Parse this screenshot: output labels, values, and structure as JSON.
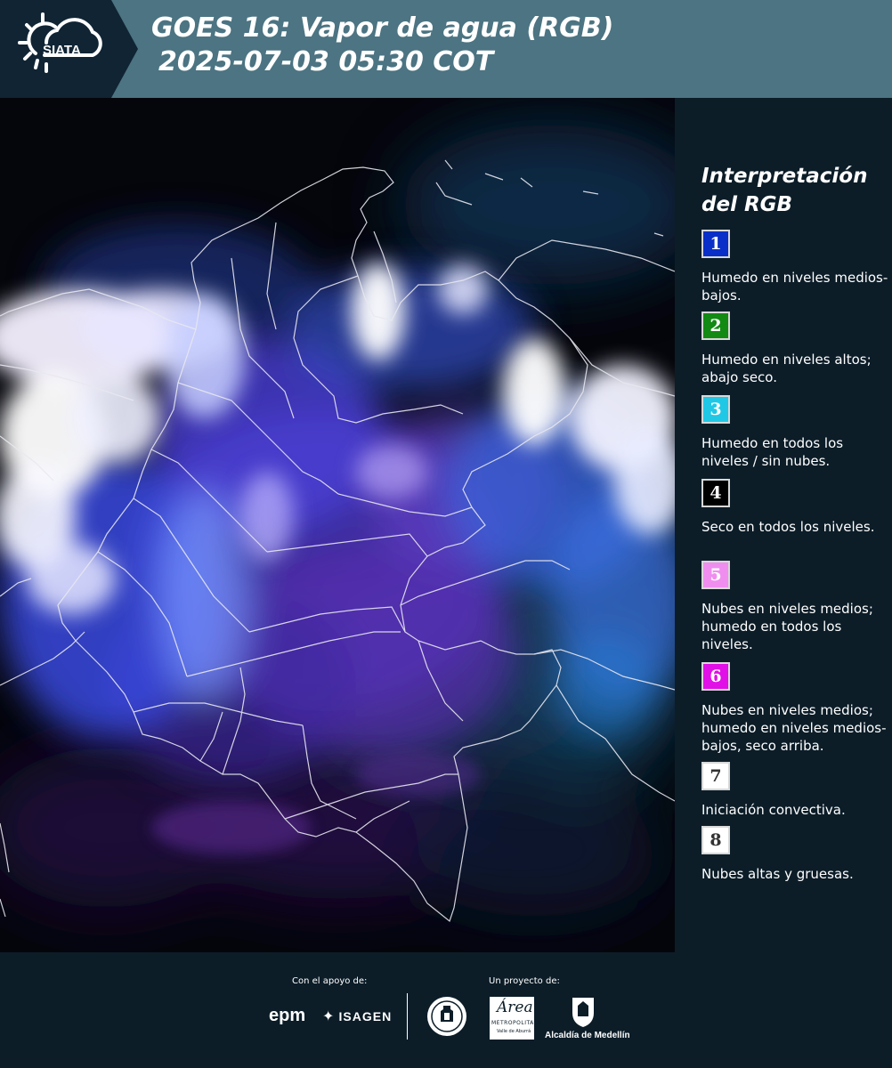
{
  "header": {
    "logo_text": "SIATA",
    "title_line1": "GOES 16: Vapor de agua (RGB)",
    "title_line2": "2025-07-03 05:30 COT"
  },
  "legend": {
    "title_line1": "Interpretación",
    "title_line2": "del RGB",
    "items": [
      {
        "number": "1",
        "color": "#0a2fc8",
        "description": "Humedo en niveles medios-bajos."
      },
      {
        "number": "2",
        "color": "#128a14",
        "description": "Humedo en niveles altos; abajo seco."
      },
      {
        "number": "3",
        "color": "#20c8e6",
        "description": "Humedo en todos los niveles / sin nubes."
      },
      {
        "number": "4",
        "color": "#000000",
        "description": "Seco en todos los niveles."
      },
      {
        "number": "5",
        "color": "#f08ef0",
        "description": "Nubes en niveles medios; humedo en todos los niveles."
      },
      {
        "number": "6",
        "color": "#e010e6",
        "description": "Nubes en niveles medios; humedo en niveles medios-bajos, seco arriba."
      },
      {
        "number": "7",
        "color": "#ffffff",
        "description": "Iniciación convectiva."
      },
      {
        "number": "8",
        "color": "#ffffff",
        "description": "Nubes altas y gruesas."
      }
    ]
  },
  "footer": {
    "support_label": "Con el apoyo de:",
    "project_label": "Un proyecto de:",
    "logos": {
      "epm": "epm",
      "isagen": "ISAGEN",
      "area_metropolitana": "Área",
      "area_subtitle": "METROPOLITANA",
      "area_subtitle2": "Valle de Aburrá",
      "alcaldia": "Alcaldía de Medellín"
    }
  }
}
